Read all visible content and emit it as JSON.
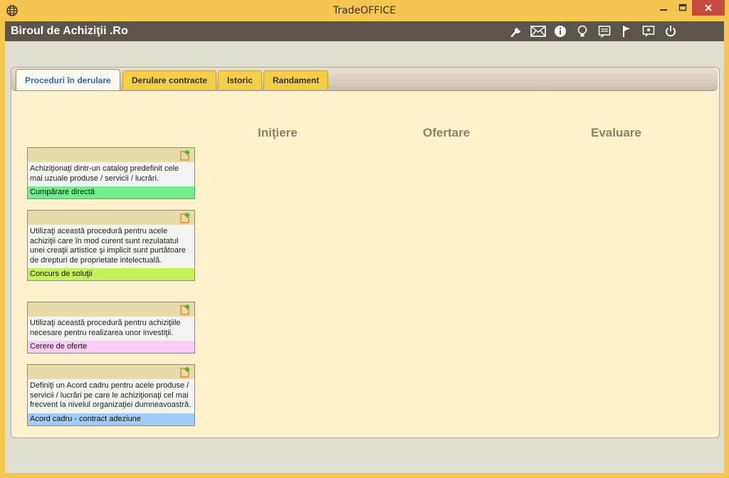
{
  "window": {
    "title": "TradeOFFICE"
  },
  "app": {
    "brand": "Biroul de Achiziţii .Ro"
  },
  "toolbar": [
    "wrench-icon",
    "mail-icon",
    "info-icon",
    "bulb-icon",
    "notes-icon",
    "flag-icon",
    "chat-icon",
    "power-icon"
  ],
  "tabs": [
    {
      "label": "Proceduri în derulare",
      "active": true
    },
    {
      "label": "Derulare contracte"
    },
    {
      "label": "Istoric"
    },
    {
      "label": "Randament"
    }
  ],
  "columns": [
    "Iniţiere",
    "Ofertare",
    "Evaluare"
  ],
  "cards": [
    {
      "desc": "Achiziţionaţi dintr-un catalog predefinit cele mai uzuale produse / servicii / lucrări.",
      "title": "Cumpărare directă",
      "color": "#6ef08a"
    },
    {
      "desc": "Utilizaţi această procedură pentru acele achiziţii care în mod curent sunt rezulatatul unei creaţii artistice şi implicit sunt purtătoare de drepturi de proprietate intelectuală.",
      "title": "Concurs de soluţii",
      "color": "#c5f25a"
    },
    {
      "desc": "Utilizaţi această procedură pentru achiziţiile necesare pentru realizarea unor investiţii.",
      "title": "Cerere de oferte",
      "color": "#fbcdf6"
    },
    {
      "desc": "Definiţi un Acord cadru pentru acele produse / servicii / lucrări pe care le achiziţionaţi cel mai frecvent la nivelul organizaţiei dumneavoastră.",
      "title": "Acord cadru - contract adeziune",
      "color": "#9fcdfb"
    }
  ]
}
